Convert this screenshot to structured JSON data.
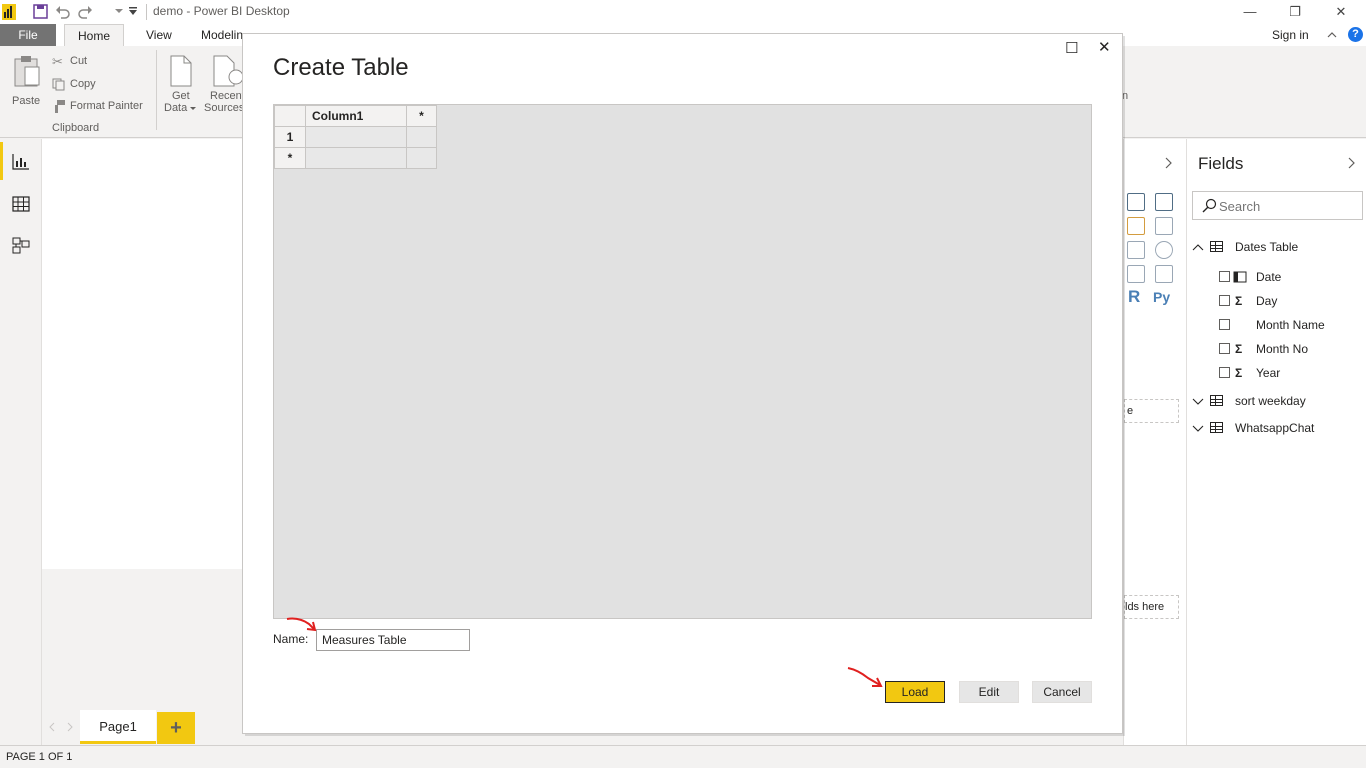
{
  "window": {
    "title": "demo - Power BI Desktop",
    "minimize_glyph": "—",
    "restore_glyph": "❐",
    "close_glyph": "✕"
  },
  "ribbon_tabs": {
    "file": "File",
    "home": "Home",
    "view": "View",
    "modeling": "Modelin",
    "sign_in": "Sign in",
    "help_glyph": "?"
  },
  "ribbon": {
    "paste": "Paste",
    "cut": "Cut",
    "copy": "Copy",
    "format_painter": "Format Painter",
    "clipboard_group": "Clipboard",
    "get_data_line1": "Get",
    "get_data_line2": "Data",
    "recent_line1": "Recent",
    "recent_line2": "Sources",
    "truncated_right": "n"
  },
  "dialog": {
    "title": "Create Table",
    "maximize_glyph": "☐",
    "close_glyph": "✕",
    "grid": {
      "column_header": "Column1",
      "add_column": "*",
      "rows": [
        "1",
        "*"
      ]
    },
    "name_label": "Name:",
    "name_value": "Measures Table",
    "load_label": "Load",
    "edit_label": "Edit",
    "cancel_label": "Cancel"
  },
  "pages": {
    "page1": "Page1",
    "add": "+",
    "status": "PAGE 1 OF 1"
  },
  "viz_pane": {
    "r_label": "R",
    "py_label": "Py",
    "partial_text_1": "e",
    "partial_text_2": "lds here"
  },
  "fields": {
    "title": "Fields",
    "search_placeholder": "Search",
    "tables": [
      {
        "name": "Dates Table",
        "expanded": true,
        "fields": [
          {
            "name": "Date",
            "kind": "calendar-icon"
          },
          {
            "name": "Day",
            "kind": "sigma"
          },
          {
            "name": "Month Name",
            "kind": "none"
          },
          {
            "name": "Month No",
            "kind": "sigma"
          },
          {
            "name": "Year",
            "kind": "sigma"
          }
        ]
      },
      {
        "name": "sort weekday",
        "expanded": false
      },
      {
        "name": "WhatsappChat",
        "expanded": false
      }
    ]
  },
  "colors": {
    "accent": "#f2c811",
    "file_tab": "#737373",
    "annotation_arrow": "#e0201f"
  }
}
